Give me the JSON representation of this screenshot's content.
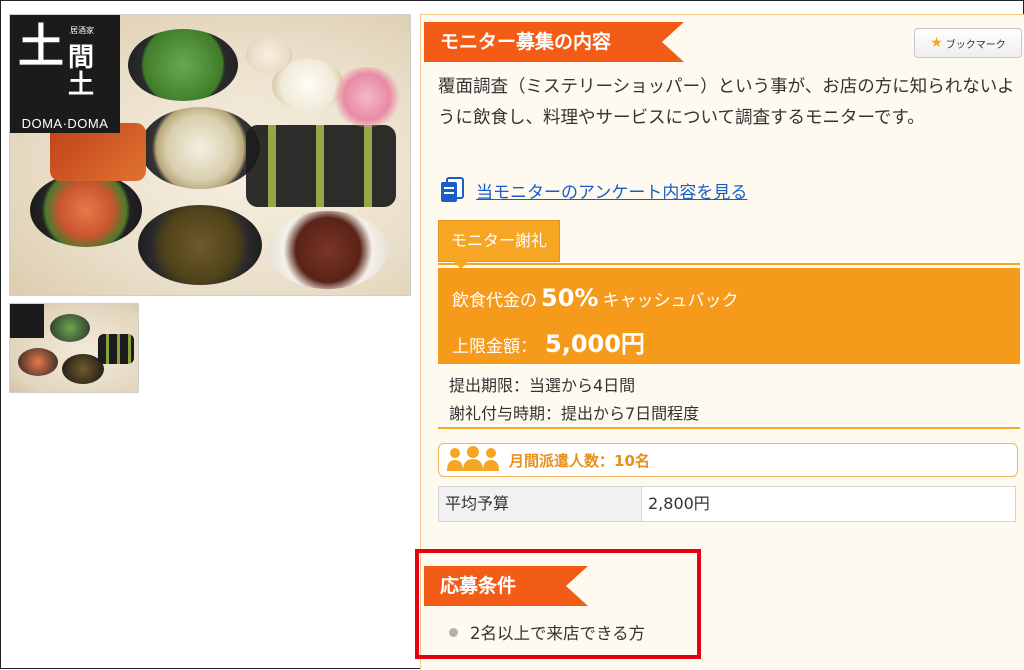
{
  "photo": {
    "logo": {
      "kanji_main": "土",
      "kanji_side": "間\n土",
      "subtitle": "居酒家",
      "name": "DOMA·DOMA"
    }
  },
  "section_monitor": {
    "title": "モニター募集の内容",
    "description": "覆面調査（ミステリーショッパー）という事が、お店の方に知られないように飲食し、料理やサービスについて調査するモニターです。",
    "survey_link": "当モニターのアンケート内容を見る"
  },
  "bookmark": {
    "label": "ブックマーク",
    "icon": "star-icon"
  },
  "reward": {
    "tab_label": "モニター謝礼",
    "line1_prefix": "飲食代金の",
    "line1_value": "50%",
    "line1_suffix": "キャッシュバック",
    "line2_prefix": "上限金額：",
    "line2_value": "5,000円",
    "deadline": "提出期限：当選から4日間",
    "payment_timing": "謝礼付与時期：提出から7日間程度"
  },
  "dispatch": {
    "label": "月間派遣人数：10名",
    "icon": "people-icon"
  },
  "budget": {
    "label": "平均予算",
    "value": "2,800円"
  },
  "conditions": {
    "title": "応募条件",
    "items": [
      "2名以上で来店できる方"
    ]
  },
  "colors": {
    "ribbon": "#f25c17",
    "reward": "#f69a1c",
    "tab": "#f6a623",
    "highlight": "#e60012",
    "link": "#1a5dc8"
  }
}
